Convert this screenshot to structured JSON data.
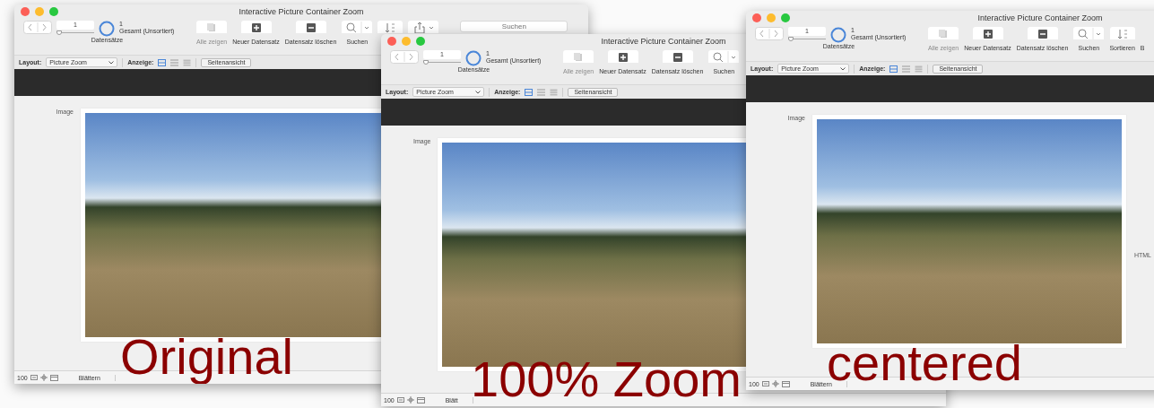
{
  "windows": [
    {
      "title": "Interactive Picture Container Zoom",
      "record_number": "1",
      "record_slider": {
        "level": 0
      },
      "found_count": "1",
      "found_status": "Gesamt (Unsortiert)",
      "records_label": "Datensätze",
      "toolbar": [
        {
          "kind": "show_all",
          "label": "Alle zeigen",
          "disabled": true
        },
        {
          "kind": "new",
          "label": "Neuer Datensatz",
          "disabled": false
        },
        {
          "kind": "delete",
          "label": "Datensatz löschen",
          "disabled": false
        },
        {
          "kind": "find",
          "label": "Suchen",
          "disabled": false
        },
        {
          "kind": "sort",
          "disabled": false
        },
        {
          "kind": "share",
          "disabled": false
        }
      ],
      "search_placeholder": "Suchen",
      "layout_label": "Layout:",
      "layout_value": "Picture Zoom",
      "view_label": "Anzeige:",
      "preview_button": "Seitenansicht",
      "field_label": "Image",
      "zoom_value": "100",
      "mode_label": "Blättern",
      "caption": "Original"
    },
    {
      "title": "Interactive Picture Container Zoom",
      "record_number": "1",
      "record_slider": {
        "level": 0
      },
      "found_count": "1",
      "found_status": "Gesamt (Unsortiert)",
      "records_label": "Datensätze",
      "toolbar": [
        {
          "kind": "show_all",
          "label": "Alle zeigen",
          "disabled": true
        },
        {
          "kind": "new",
          "label": "Neuer Datensatz",
          "disabled": false
        },
        {
          "kind": "delete",
          "label": "Datensatz löschen",
          "disabled": false
        },
        {
          "kind": "find",
          "label": "Suchen",
          "disabled": false
        }
      ],
      "layout_label": "Layout:",
      "layout_value": "Picture Zoom",
      "view_label": "Anzeige:",
      "preview_button": "Seitenansicht",
      "field_label": "Image",
      "zoom_value": "100",
      "mode_label": "Blätt",
      "caption": "100% Zoom"
    },
    {
      "title": "Interactive Picture Container Zoom",
      "record_number": "1",
      "record_slider": {
        "level": 0
      },
      "found_count": "1",
      "found_status": "Gesamt (Unsortiert)",
      "records_label": "Datensätze",
      "toolbar": [
        {
          "kind": "show_all",
          "label": "Alle zeigen",
          "disabled": true
        },
        {
          "kind": "new",
          "label": "Neuer Datensatz",
          "disabled": false
        },
        {
          "kind": "delete",
          "label": "Datensatz löschen",
          "disabled": false
        },
        {
          "kind": "find",
          "label": "Suchen",
          "disabled": false
        },
        {
          "kind": "sort",
          "label": "Sortieren",
          "disabled": false
        },
        {
          "kind": "text",
          "label": "B",
          "disabled": false
        }
      ],
      "layout_label": "Layout:",
      "layout_value": "Picture Zoom",
      "view_label": "Anzeige:",
      "preview_button": "Seitenansicht",
      "field_label": "Image",
      "html_label": "HTML",
      "zoom_value": "100",
      "mode_label": "Blättern",
      "caption": "centered"
    }
  ]
}
